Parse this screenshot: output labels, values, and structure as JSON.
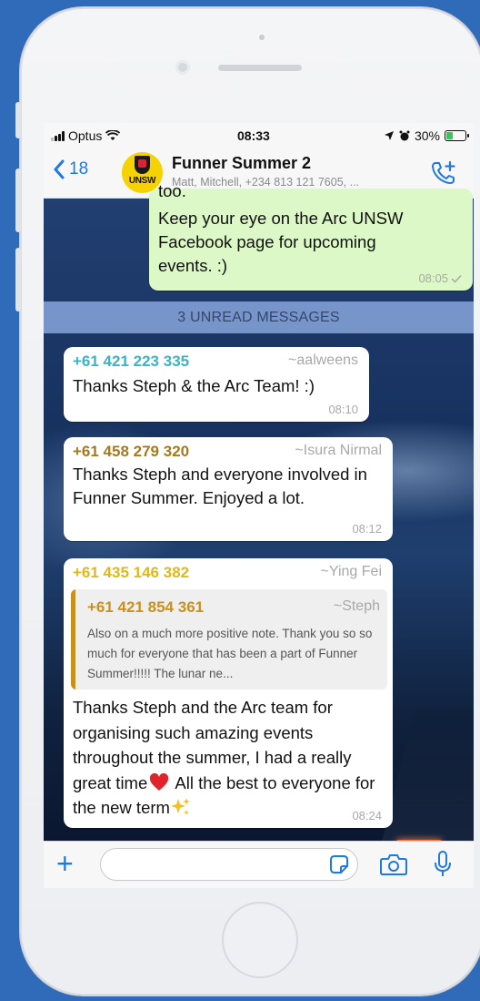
{
  "status": {
    "carrier": "Optus",
    "time": "08:33",
    "battery": "30%",
    "battery_level": 0.3
  },
  "header": {
    "back_count": "18",
    "title": "Funner Summer 2",
    "subtitle": "Matt, Mitchell, +234 813 121 7605, ...",
    "avatar_text": "UNSW"
  },
  "messages": {
    "m0": {
      "text_top": "too.",
      "text": "Keep your eye on the Arc UNSW Facebook page for upcoming events. :)",
      "time": "08:05"
    },
    "unread_label": "3 UNREAD MESSAGES",
    "m1": {
      "sender": "+61 421 223 335",
      "alias": "~aalweens",
      "text": "Thanks Steph & the Arc Team! :)",
      "time": "08:10",
      "sender_color": "#3bb3c3"
    },
    "m2": {
      "sender": "+61 458 279 320",
      "alias": "~Isura Nirmal",
      "text": "Thanks Steph and everyone involved in Funner Summer. Enjoyed a lot.",
      "time": "08:12",
      "sender_color": "#a6791d"
    },
    "m3": {
      "sender": "+61 435 146 382",
      "alias": "~Ying Fei",
      "sender_color": "#e0b81a",
      "quote": {
        "sender": "+61 421 854 361",
        "alias": "~Steph",
        "text": "Also on a much more positive note. Thank you so so much for everyone that has been a part of Funner Summer!!!!! The lunar ne..."
      },
      "text": "Thanks Steph and the Arc team for organising such amazing events throughout the summer, I had a really great time",
      "text_end": "All the best to everyone for the new term",
      "time": "08:24"
    }
  },
  "input": {
    "placeholder": ""
  },
  "colors": {
    "accent": "#1f7ae0",
    "outgoing_bubble": "#dcf8c6",
    "incoming_bubble": "#ffffff"
  }
}
